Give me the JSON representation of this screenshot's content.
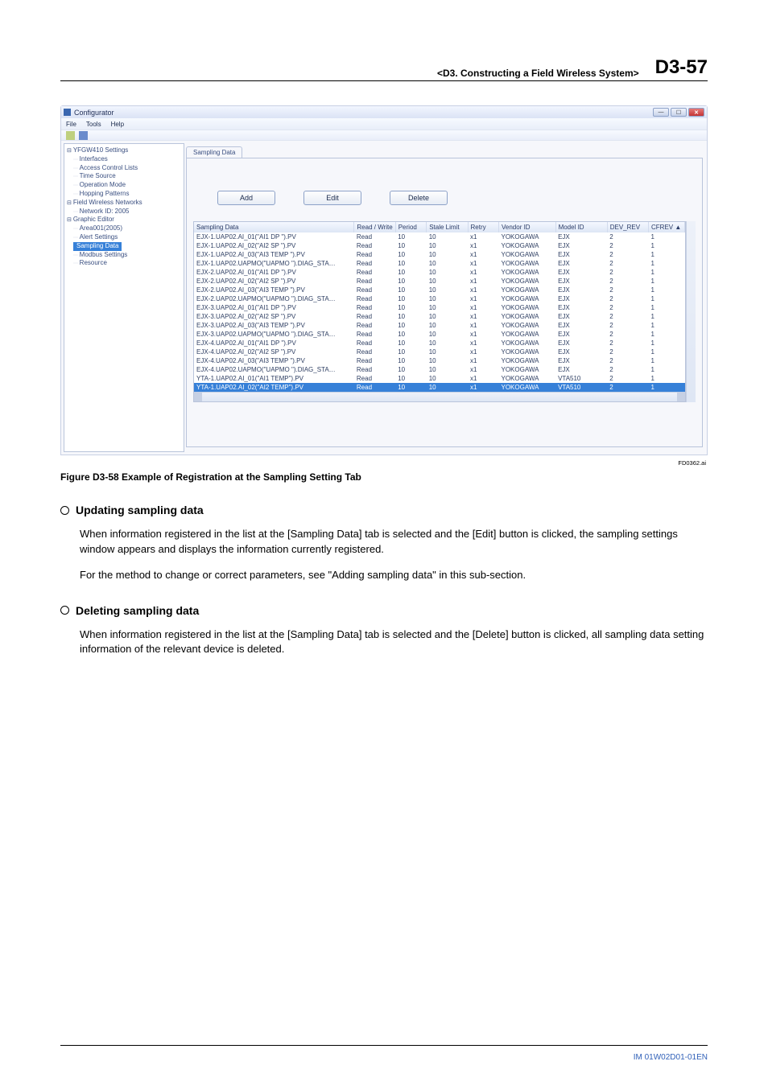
{
  "header": {
    "breadcrumb": "<D3.  Constructing a Field Wireless System>",
    "page": "D3-57"
  },
  "window": {
    "title": "Configurator",
    "menu": [
      "File",
      "Tools",
      "Help"
    ]
  },
  "tree": {
    "root": "YFGW410 Settings",
    "items_a": [
      "Interfaces",
      "Access Control Lists",
      "Time Source",
      "Operation Mode",
      "Hopping Patterns"
    ],
    "fwn": "Field Wireless Networks",
    "fwn_child": "Network ID: 2005",
    "ge": "Graphic Editor",
    "area": "Area001(2005)",
    "items_b": [
      "Alert Settings"
    ],
    "selected": "Sampling Data",
    "items_c": [
      "Modbus Settings",
      "Resource"
    ]
  },
  "tab_label": "Sampling Data",
  "buttons": {
    "add": "Add",
    "edit": "Edit",
    "del": "Delete"
  },
  "columns": [
    "Sampling Data",
    "Read / Write",
    "Period",
    "Stale Limit",
    "Retry",
    "Vendor ID",
    "Model ID",
    "DEV_REV",
    "CFREV"
  ],
  "rows": [
    {
      "sd": "EJX-1.UAP02.AI_01(\"AI1 DP    \").PV",
      "rw": "Read",
      "pd": "10",
      "sl": "10",
      "rt": "x1",
      "vid": "YOKOGAWA",
      "mid": "EJX",
      "dr": "2",
      "cf": "1"
    },
    {
      "sd": "EJX-1.UAP02.AI_02(\"AI2 SP    \").PV",
      "rw": "Read",
      "pd": "10",
      "sl": "10",
      "rt": "x1",
      "vid": "YOKOGAWA",
      "mid": "EJX",
      "dr": "2",
      "cf": "1"
    },
    {
      "sd": "EJX-1.UAP02.AI_03(\"AI3 TEMP \").PV",
      "rw": "Read",
      "pd": "10",
      "sl": "10",
      "rt": "x1",
      "vid": "YOKOGAWA",
      "mid": "EJX",
      "dr": "2",
      "cf": "1"
    },
    {
      "sd": "EJX-1.UAP02.UAPMO(\"UAPMO \").DIAG_STA…",
      "rw": "Read",
      "pd": "10",
      "sl": "10",
      "rt": "x1",
      "vid": "YOKOGAWA",
      "mid": "EJX",
      "dr": "2",
      "cf": "1"
    },
    {
      "sd": "EJX-2.UAP02.AI_01(\"AI1 DP    \").PV",
      "rw": "Read",
      "pd": "10",
      "sl": "10",
      "rt": "x1",
      "vid": "YOKOGAWA",
      "mid": "EJX",
      "dr": "2",
      "cf": "1"
    },
    {
      "sd": "EJX-2.UAP02.AI_02(\"AI2 SP    \").PV",
      "rw": "Read",
      "pd": "10",
      "sl": "10",
      "rt": "x1",
      "vid": "YOKOGAWA",
      "mid": "EJX",
      "dr": "2",
      "cf": "1"
    },
    {
      "sd": "EJX-2.UAP02.AI_03(\"AI3 TEMP \").PV",
      "rw": "Read",
      "pd": "10",
      "sl": "10",
      "rt": "x1",
      "vid": "YOKOGAWA",
      "mid": "EJX",
      "dr": "2",
      "cf": "1"
    },
    {
      "sd": "EJX-2.UAP02.UAPMO(\"UAPMO \").DIAG_STA…",
      "rw": "Read",
      "pd": "10",
      "sl": "10",
      "rt": "x1",
      "vid": "YOKOGAWA",
      "mid": "EJX",
      "dr": "2",
      "cf": "1"
    },
    {
      "sd": "EJX-3.UAP02.AI_01(\"AI1 DP    \").PV",
      "rw": "Read",
      "pd": "10",
      "sl": "10",
      "rt": "x1",
      "vid": "YOKOGAWA",
      "mid": "EJX",
      "dr": "2",
      "cf": "1"
    },
    {
      "sd": "EJX-3.UAP02.AI_02(\"AI2 SP    \").PV",
      "rw": "Read",
      "pd": "10",
      "sl": "10",
      "rt": "x1",
      "vid": "YOKOGAWA",
      "mid": "EJX",
      "dr": "2",
      "cf": "1"
    },
    {
      "sd": "EJX-3.UAP02.AI_03(\"AI3 TEMP \").PV",
      "rw": "Read",
      "pd": "10",
      "sl": "10",
      "rt": "x1",
      "vid": "YOKOGAWA",
      "mid": "EJX",
      "dr": "2",
      "cf": "1"
    },
    {
      "sd": "EJX-3.UAP02.UAPMO(\"UAPMO \").DIAG_STA…",
      "rw": "Read",
      "pd": "10",
      "sl": "10",
      "rt": "x1",
      "vid": "YOKOGAWA",
      "mid": "EJX",
      "dr": "2",
      "cf": "1"
    },
    {
      "sd": "EJX-4.UAP02.AI_01(\"AI1 DP    \").PV",
      "rw": "Read",
      "pd": "10",
      "sl": "10",
      "rt": "x1",
      "vid": "YOKOGAWA",
      "mid": "EJX",
      "dr": "2",
      "cf": "1"
    },
    {
      "sd": "EJX-4.UAP02.AI_02(\"AI2 SP    \").PV",
      "rw": "Read",
      "pd": "10",
      "sl": "10",
      "rt": "x1",
      "vid": "YOKOGAWA",
      "mid": "EJX",
      "dr": "2",
      "cf": "1"
    },
    {
      "sd": "EJX-4.UAP02.AI_03(\"AI3 TEMP \").PV",
      "rw": "Read",
      "pd": "10",
      "sl": "10",
      "rt": "x1",
      "vid": "YOKOGAWA",
      "mid": "EJX",
      "dr": "2",
      "cf": "1"
    },
    {
      "sd": "EJX-4.UAP02.UAPMO(\"UAPMO \").DIAG_STA…",
      "rw": "Read",
      "pd": "10",
      "sl": "10",
      "rt": "x1",
      "vid": "YOKOGAWA",
      "mid": "EJX",
      "dr": "2",
      "cf": "1"
    },
    {
      "sd": "YTA-1.UAP02.AI_01(\"AI1 TEMP\").PV",
      "rw": "Read",
      "pd": "10",
      "sl": "10",
      "rt": "x1",
      "vid": "YOKOGAWA",
      "mid": "VTA510",
      "dr": "2",
      "cf": "1"
    },
    {
      "sd": "YTA-1.UAP02.AI_02(\"AI2 TEMP\").PV",
      "rw": "Read",
      "pd": "10",
      "sl": "10",
      "rt": "x1",
      "vid": "YOKOGAWA",
      "mid": "VTA510",
      "dr": "2",
      "cf": "1"
    }
  ],
  "figref": "FD0362.ai",
  "figcap": "Figure D3-58 Example of Registration at the Sampling Setting Tab",
  "section1_h": "Updating sampling data",
  "section1_p1": "When information registered in the list at the [Sampling Data] tab is selected and the [Edit] button is clicked, the sampling settings window appears and displays the information currently registered.",
  "section1_p2": "For the method to change or correct parameters, see \"Adding sampling data\" in this sub-section.",
  "section2_h": "Deleting sampling data",
  "section2_p1": "When information registered in the list at the [Sampling Data] tab is selected and the [Delete] button is clicked, all sampling data setting information of the relevant device is deleted.",
  "docid": "IM 01W02D01-01EN"
}
